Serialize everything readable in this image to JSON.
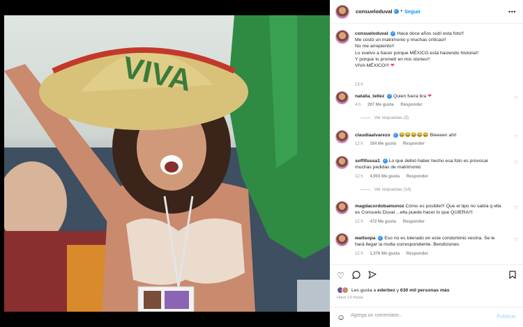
{
  "post": {
    "username": "consueloduval",
    "follow_label": "Seguir",
    "caption_lines": [
      "Hace doce años subí esta foto!!",
      "Me costó un matrimonio y muchas críticas!!",
      "No me arrepiento!!",
      "Lo vuelvo a hacer porque MÉXICO esta haciendo historia!!",
      "Y porque lo prometí en mis stories!!",
      "VIVA MÉXICO!!!"
    ],
    "caption_time": "13 h"
  },
  "comments": [
    {
      "user": "natalia_tellez",
      "text": "Quien fuera bra",
      "time": "4 h",
      "likes": "297 Me gusta",
      "reply": "Responder",
      "replies": "Ver respuestas (3)"
    },
    {
      "user": "claudiaalvarezo",
      "text": "😂😂😂😂😂 Bieeeen ahí!",
      "time": "12 h",
      "likes": "164 Me gusta",
      "reply": "Responder"
    },
    {
      "user": "soffifussa1",
      "text": "Lo que debió haber hecho esa foto es provocar muchas pedidas de matrimonio",
      "time": "12 h",
      "likes": "4,903 Me gusta",
      "reply": "Responder",
      "replies": "Ver respuestas (14)"
    },
    {
      "user": "magdacordobamunoz",
      "text": "Cómo es posible!!! Que el tipo no sabía q ella es Consuelo Duval ...ella puede hacer lo que QUIERA!!!",
      "time": "12 h",
      "likes": "472 Me gusta",
      "reply": "Responder"
    },
    {
      "user": "wattsopa",
      "text": "Eso no es tolerado en este condominio vecina. Se le hará llegar la multa correspondiente. Bendiciones",
      "time": "12 h",
      "likes": "1,376 Me gusta",
      "reply": "Responder"
    }
  ],
  "likes": {
    "prefix": "Les gusta a",
    "user": "ederbez",
    "middle": "y",
    "others": "630 mil personas más"
  },
  "posted_ago": "Hace 13 horas",
  "add_comment": {
    "placeholder": "Agrega un comentario...",
    "publish_label": "Publicar"
  },
  "photo": {
    "hat_text": "VIVA"
  },
  "colors": {
    "accent": "#0095f6",
    "verified": "#3897f0",
    "heart": "#ed4956",
    "flag_green": "#2f8a43"
  },
  "icons": [
    "more-icon",
    "verified-icon",
    "heart-icon",
    "comment-icon",
    "share-icon",
    "save-icon",
    "emoji-icon"
  ]
}
